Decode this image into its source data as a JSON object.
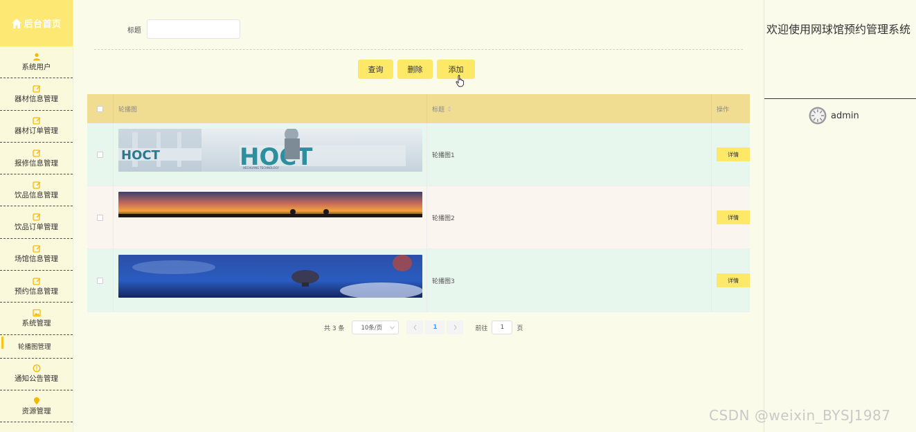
{
  "sidebar": {
    "brand_title": "后台首页",
    "items": [
      {
        "label": "系统用户",
        "icon": "user-icon"
      },
      {
        "label": "器材信息管理",
        "icon": "edit-icon"
      },
      {
        "label": "器材订单管理",
        "icon": "edit-icon"
      },
      {
        "label": "报修信息管理",
        "icon": "edit-icon"
      },
      {
        "label": "饮品信息管理",
        "icon": "edit-icon"
      },
      {
        "label": "饮品订单管理",
        "icon": "edit-icon"
      },
      {
        "label": "场馆信息管理",
        "icon": "edit-icon"
      },
      {
        "label": "预约信息管理",
        "icon": "edit-icon"
      },
      {
        "label": "系统管理",
        "icon": "image-icon"
      }
    ],
    "submenu_active": "轮播图管理",
    "items_after": [
      {
        "label": "通知公告管理",
        "icon": "info-icon"
      },
      {
        "label": "资源管理",
        "icon": "location-icon"
      }
    ],
    "accent_color": "#fde873"
  },
  "search": {
    "label": "标题",
    "value": "",
    "placeholder": ""
  },
  "actions": {
    "query": "查询",
    "delete": "删除",
    "add": "添加"
  },
  "table": {
    "headers": {
      "image": "轮播图",
      "title": "标题",
      "operation": "操作"
    },
    "rows": [
      {
        "title": "轮播图1",
        "detail": "详情"
      },
      {
        "title": "轮播图2",
        "detail": "详情"
      },
      {
        "title": "轮播图3",
        "detail": "详情"
      }
    ]
  },
  "pagination": {
    "total": "共 3 条",
    "page_size": "10条/页",
    "current_page": "1",
    "goto_label": "前往",
    "goto_value": "1",
    "page_suffix": "页"
  },
  "header": {
    "welcome": "欢迎使用网球馆预约管理系统",
    "username": "admin"
  },
  "watermark": "CSDN @weixin_BYSJ1987"
}
